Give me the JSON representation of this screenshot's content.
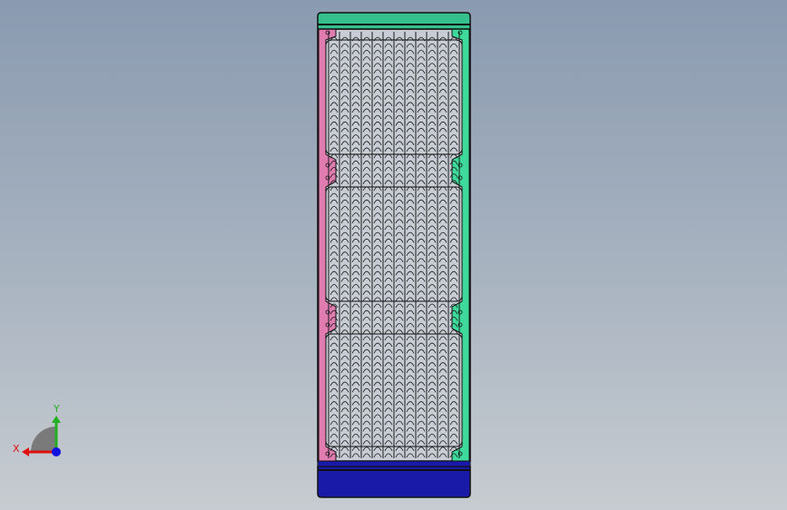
{
  "app": {
    "title": "",
    "background_top": "#8a9ab0",
    "background_bottom": "#c7ccd1"
  },
  "model": {
    "name": "radiator",
    "colors": {
      "top_cap": "#35c08e",
      "bottom_cap": "#1a1aa8",
      "left_bracket": "#e07cb0",
      "right_bracket": "#3fd99b",
      "fin_fill": "#c8ccd4",
      "fin_hatch": "#1a1a1a",
      "outline": "#111111"
    },
    "fin_columns": 12,
    "fin_rows": 65,
    "sections": 3
  },
  "triad": {
    "x_label": "X",
    "y_label": "Y",
    "x_color": "#e01010",
    "y_color": "#20b020",
    "z_color": "#1010e0",
    "shadow_color": "#7a7a7a"
  }
}
